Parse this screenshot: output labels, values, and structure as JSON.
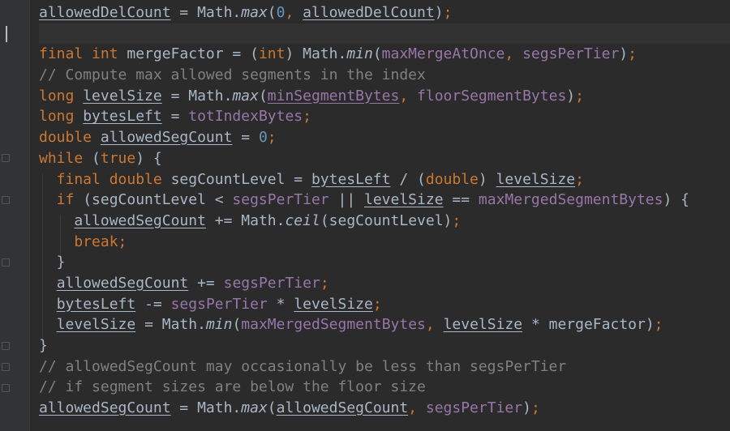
{
  "colors": {
    "background": "#2b2b2b",
    "keyword": "#cc7832",
    "number": "#6897bb",
    "comment": "#808080",
    "field": "#9876aa",
    "default": "#a9b7c6"
  },
  "code_lines": [
    [
      {
        "t": "allowedDelCount",
        "c": "pl ul"
      },
      {
        "t": " = Math.",
        "c": "pl"
      },
      {
        "t": "max",
        "c": "pl it"
      },
      {
        "t": "(",
        "c": "pl"
      },
      {
        "t": "0",
        "c": "num"
      },
      {
        "t": ", ",
        "c": "kw"
      },
      {
        "t": "allowedDelCount",
        "c": "pl ul"
      },
      {
        "t": ")",
        "c": "pl"
      },
      {
        "t": ";",
        "c": "kw"
      }
    ],
    [],
    [
      {
        "t": "final int ",
        "c": "kw"
      },
      {
        "t": "mergeFactor = (",
        "c": "pl"
      },
      {
        "t": "int",
        "c": "kw"
      },
      {
        "t": ") Math.",
        "c": "pl"
      },
      {
        "t": "min",
        "c": "pl it"
      },
      {
        "t": "(",
        "c": "pl"
      },
      {
        "t": "maxMergeAtOnce",
        "c": "fld"
      },
      {
        "t": ", ",
        "c": "kw"
      },
      {
        "t": "segsPerTier",
        "c": "fld"
      },
      {
        "t": ")",
        "c": "pl"
      },
      {
        "t": ";",
        "c": "kw"
      }
    ],
    [
      {
        "t": "// Compute max allowed segments in the index",
        "c": "cmt"
      }
    ],
    [
      {
        "t": "long ",
        "c": "kw"
      },
      {
        "t": "levelSize",
        "c": "pl ul"
      },
      {
        "t": " = Math.",
        "c": "pl"
      },
      {
        "t": "max",
        "c": "pl it"
      },
      {
        "t": "(",
        "c": "pl"
      },
      {
        "t": "minSegmentBytes",
        "c": "fld ul"
      },
      {
        "t": ", ",
        "c": "kw"
      },
      {
        "t": "floorSegmentBytes",
        "c": "fld"
      },
      {
        "t": ")",
        "c": "pl"
      },
      {
        "t": ";",
        "c": "kw"
      }
    ],
    [
      {
        "t": "long ",
        "c": "kw"
      },
      {
        "t": "bytesLeft",
        "c": "pl ul"
      },
      {
        "t": " = ",
        "c": "pl"
      },
      {
        "t": "totIndexBytes",
        "c": "fld"
      },
      {
        "t": ";",
        "c": "kw"
      }
    ],
    [
      {
        "t": "double ",
        "c": "kw"
      },
      {
        "t": "allowedSegCount",
        "c": "pl ul"
      },
      {
        "t": " = ",
        "c": "pl"
      },
      {
        "t": "0",
        "c": "num"
      },
      {
        "t": ";",
        "c": "kw"
      }
    ],
    [
      {
        "t": "while ",
        "c": "kw"
      },
      {
        "t": "(",
        "c": "pl"
      },
      {
        "t": "true",
        "c": "kw"
      },
      {
        "t": ") {",
        "c": "pl"
      }
    ],
    [
      {
        "t": "  final double ",
        "c": "kw"
      },
      {
        "t": "segCountLevel = ",
        "c": "pl"
      },
      {
        "t": "bytesLeft",
        "c": "pl ul"
      },
      {
        "t": " / (",
        "c": "pl"
      },
      {
        "t": "double",
        "c": "kw"
      },
      {
        "t": ") ",
        "c": "pl"
      },
      {
        "t": "levelSize",
        "c": "pl ul"
      },
      {
        "t": ";",
        "c": "kw"
      }
    ],
    [
      {
        "t": "  if ",
        "c": "kw"
      },
      {
        "t": "(segCountLevel < ",
        "c": "pl"
      },
      {
        "t": "segsPerTier",
        "c": "fld"
      },
      {
        "t": " || ",
        "c": "pl"
      },
      {
        "t": "levelSize",
        "c": "pl ul"
      },
      {
        "t": " == ",
        "c": "pl"
      },
      {
        "t": "maxMergedSegmentBytes",
        "c": "fld"
      },
      {
        "t": ") {",
        "c": "pl"
      }
    ],
    [
      {
        "t": "    ",
        "c": "pl"
      },
      {
        "t": "allowedSegCount",
        "c": "pl ul"
      },
      {
        "t": " += Math.",
        "c": "pl"
      },
      {
        "t": "ceil",
        "c": "pl it"
      },
      {
        "t": "(segCountLevel)",
        "c": "pl"
      },
      {
        "t": ";",
        "c": "kw"
      }
    ],
    [
      {
        "t": "    break;",
        "c": "kw"
      }
    ],
    [
      {
        "t": "  }",
        "c": "pl"
      }
    ],
    [
      {
        "t": "  ",
        "c": "pl"
      },
      {
        "t": "allowedSegCount",
        "c": "pl ul"
      },
      {
        "t": " += ",
        "c": "pl"
      },
      {
        "t": "segsPerTier",
        "c": "fld"
      },
      {
        "t": ";",
        "c": "kw"
      }
    ],
    [
      {
        "t": "  ",
        "c": "pl"
      },
      {
        "t": "bytesLeft",
        "c": "pl ul"
      },
      {
        "t": " -= ",
        "c": "pl"
      },
      {
        "t": "segsPerTier",
        "c": "fld"
      },
      {
        "t": " * ",
        "c": "pl"
      },
      {
        "t": "levelSize",
        "c": "pl ul"
      },
      {
        "t": ";",
        "c": "kw"
      }
    ],
    [
      {
        "t": "  ",
        "c": "pl"
      },
      {
        "t": "levelSize",
        "c": "pl ul"
      },
      {
        "t": " = Math.",
        "c": "pl"
      },
      {
        "t": "min",
        "c": "pl it"
      },
      {
        "t": "(",
        "c": "pl"
      },
      {
        "t": "maxMergedSegmentBytes",
        "c": "fld"
      },
      {
        "t": ", ",
        "c": "kw"
      },
      {
        "t": "levelSize",
        "c": "pl ul"
      },
      {
        "t": " * mergeFactor)",
        "c": "pl"
      },
      {
        "t": ";",
        "c": "kw"
      }
    ],
    [
      {
        "t": "}",
        "c": "pl"
      }
    ],
    [
      {
        "t": "// allowedSegCount may occasionally be less than segsPerTier",
        "c": "cmt"
      }
    ],
    [
      {
        "t": "// if segment sizes are below the floor size",
        "c": "cmt"
      }
    ],
    [
      {
        "t": "allowedSegCount",
        "c": "pl ul"
      },
      {
        "t": " = Math.",
        "c": "pl"
      },
      {
        "t": "max",
        "c": "pl it"
      },
      {
        "t": "(",
        "c": "pl"
      },
      {
        "t": "allowedSegCount",
        "c": "pl ul"
      },
      {
        "t": ", ",
        "c": "kw"
      },
      {
        "t": "segsPerTier",
        "c": "fld"
      },
      {
        "t": ")",
        "c": "pl"
      },
      {
        "t": ";",
        "c": "kw"
      }
    ]
  ]
}
